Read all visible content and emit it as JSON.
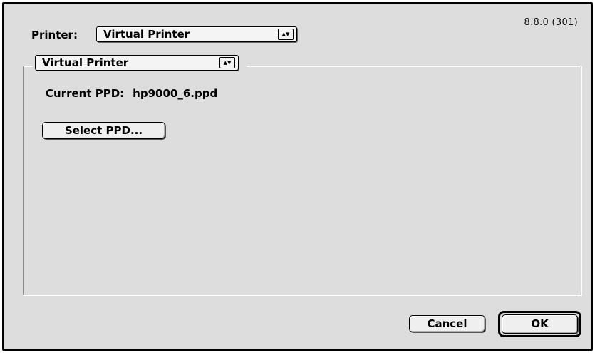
{
  "dialog": {
    "version": "8.8.0 (301)",
    "printer_label": "Printer:",
    "printer_selected": "Virtual Printer",
    "panel_selected": "Virtual Printer",
    "ppd_label": "Current PPD:",
    "ppd_value": "hp9000_6.ppd",
    "select_ppd_label": "Select PPD...",
    "cancel_label": "Cancel",
    "ok_label": "OK"
  },
  "icons": {
    "popup_arrow": "up-down-arrows-icon"
  },
  "colors": {
    "dialog_background": "#dddddd",
    "border": "#000000"
  }
}
